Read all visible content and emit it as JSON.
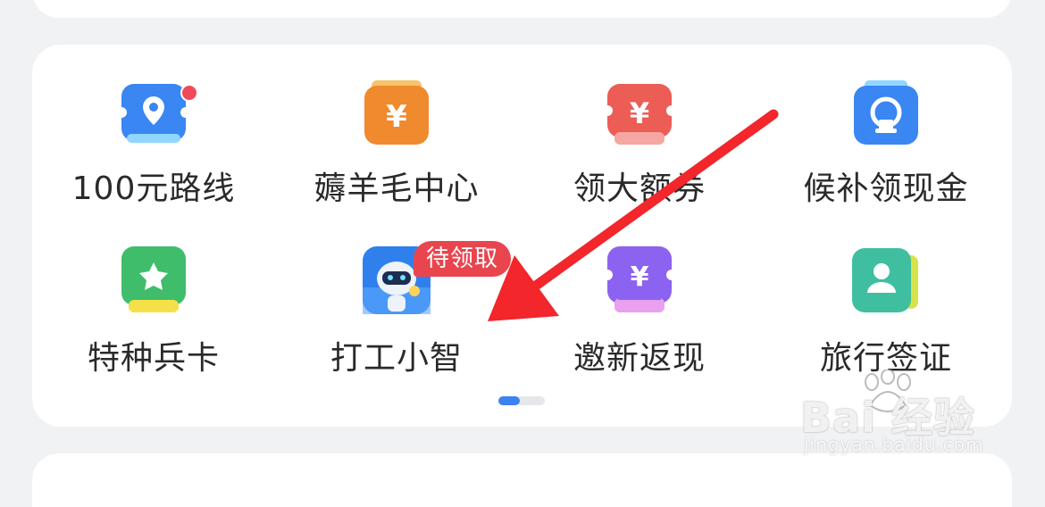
{
  "grid": {
    "items": [
      {
        "label": "100元路线",
        "icon": "ticket-location-icon",
        "color": "#3a86f2"
      },
      {
        "label": "薅羊毛中心",
        "icon": "yuan-coupon-icon",
        "color": "#f08a2e"
      },
      {
        "label": "领大额券",
        "icon": "yuan-ticket-icon",
        "color": "#ec5d55"
      },
      {
        "label": "候补领现金",
        "icon": "train-ticket-icon",
        "color": "#3a86f2"
      },
      {
        "label": "特种兵卡",
        "icon": "star-card-icon",
        "color": "#3fbd6a"
      },
      {
        "label": "打工小智",
        "icon": "robot-avatar-icon",
        "color": "#2f80ed"
      },
      {
        "label": "邀新返现",
        "icon": "yuan-ticket-icon",
        "color": "#8b63f0"
      },
      {
        "label": "旅行签证",
        "icon": "visa-person-icon",
        "color": "#3fbf9f"
      }
    ]
  },
  "badges": {
    "robot": "待领取"
  },
  "pager": {
    "pages": 2,
    "active": 1
  },
  "watermark": {
    "main": "Bai 经验",
    "du": "du",
    "sub": "jingyan.baidu.com"
  },
  "colors": {
    "arrow": "#f2262b",
    "accent": "#3d82f0",
    "badge": "#e9454f"
  }
}
